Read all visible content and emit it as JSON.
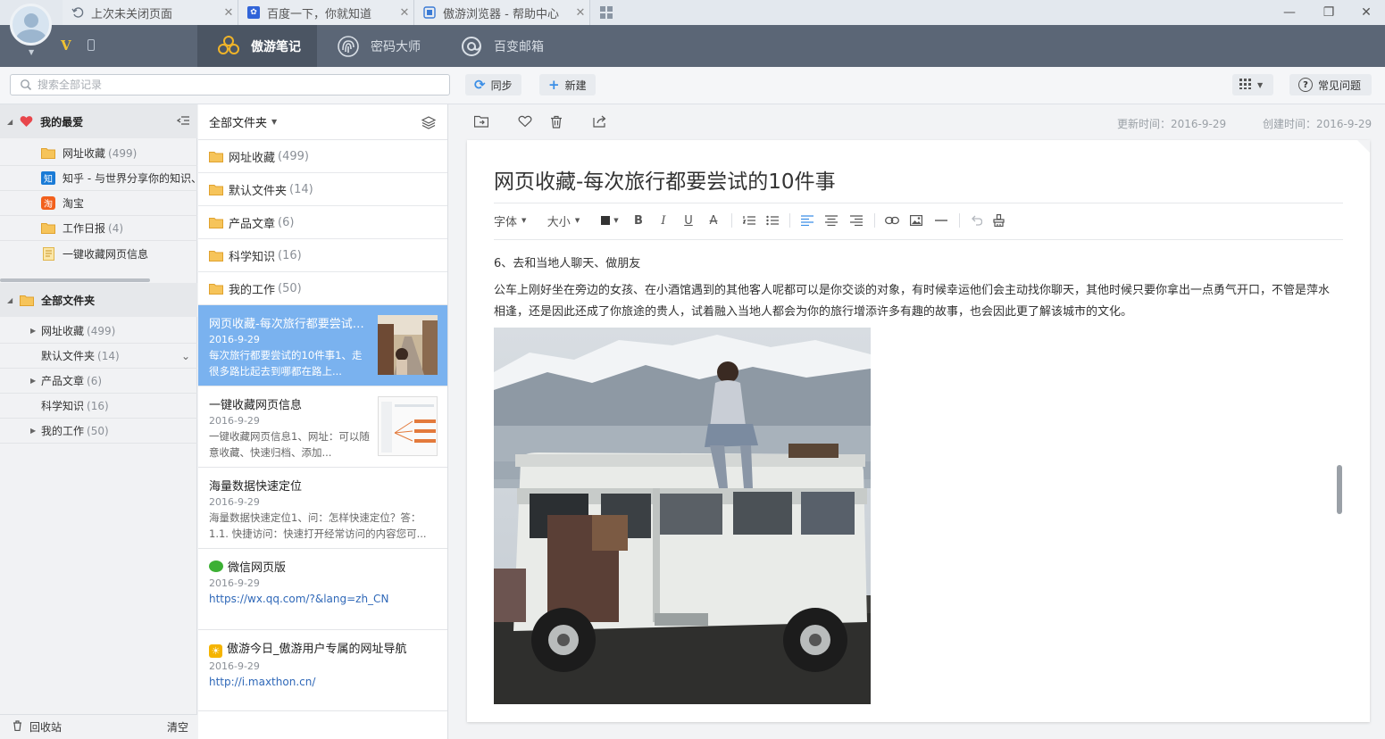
{
  "tabs": [
    {
      "label": "上次未关闭页面",
      "icon": "restore-icon"
    },
    {
      "label": "百度一下，你就知道",
      "icon": "baidu-icon"
    },
    {
      "label": "傲游浏览器 - 帮助中心",
      "icon": "maxthon-icon"
    }
  ],
  "header": {
    "badge": "V",
    "nav": [
      {
        "label": "傲游笔记",
        "icon": "note-flower-icon"
      },
      {
        "label": "密码大师",
        "icon": "fingerprint-icon"
      },
      {
        "label": "百变邮箱",
        "icon": "at-mail-icon"
      }
    ]
  },
  "toolbar": {
    "search_placeholder": "搜索全部记录",
    "sync_label": "同步",
    "new_label": "新建",
    "faq_label": "常见问题"
  },
  "sidebar": {
    "favorites_title": "我的最爱",
    "favorites": [
      {
        "label": "网址收藏",
        "count": "(499)",
        "icon": "folder-icon"
      },
      {
        "label": "知乎 - 与世界分享你的知识、",
        "count": "",
        "icon": "zhihu-icon"
      },
      {
        "label": "淘宝",
        "count": "",
        "icon": "taobao-icon"
      },
      {
        "label": "工作日报",
        "count": "(4)",
        "icon": "folder-icon"
      },
      {
        "label": "一键收藏网页信息",
        "count": "",
        "icon": "note-icon"
      }
    ],
    "folders_title": "全部文件夹",
    "folders": [
      {
        "label": "网址收藏",
        "count": "(499)"
      },
      {
        "label": "默认文件夹",
        "count": "(14)"
      },
      {
        "label": "产品文章",
        "count": "(6)"
      },
      {
        "label": "科学知识",
        "count": "(16)"
      },
      {
        "label": "我的工作",
        "count": "(50)"
      }
    ],
    "trash_label": "回收站",
    "clear_label": "清空"
  },
  "list": {
    "header": "全部文件夹",
    "folders": [
      {
        "label": "网址收藏",
        "count": "(499)"
      },
      {
        "label": "默认文件夹",
        "count": "(14)"
      },
      {
        "label": "产品文章",
        "count": "(6)"
      },
      {
        "label": "科学知识",
        "count": "(16)"
      },
      {
        "label": "我的工作",
        "count": "(50)"
      }
    ],
    "notes": [
      {
        "title": "网页收藏-每次旅行都要尝试的10件事",
        "date": "2016-9-29",
        "snippet": "每次旅行都要尝试的10件事1、走很多路比起去到哪都在路上..."
      },
      {
        "title": "一键收藏网页信息",
        "date": "2016-9-29",
        "snippet": "一键收藏网页信息1、网址：可以随意收藏、快速归档、添加..."
      },
      {
        "title": "海量数据快速定位",
        "date": "2016-9-29",
        "snippet": "海量数据快速定位1、问：怎样快速定位？答：1.1. 快捷访问：快速打开经常访问的内容您可..."
      },
      {
        "title": "微信网页版",
        "date": "2016-9-29",
        "link": "https://wx.qq.com/?&lang=zh_CN"
      },
      {
        "title": "傲游今日_傲游用户专属的网址导航",
        "date": "2016-9-29",
        "link": "http://i.maxthon.cn/"
      }
    ]
  },
  "editor": {
    "updated": "更新时间：2016-9-29",
    "created": "创建时间：2016-9-29",
    "title": "网页收藏-每次旅行都要尝试的10件事",
    "font_label": "字体",
    "size_label": "大小",
    "heading": "6、去和当地人聊天、做朋友",
    "paragraph": "公车上刚好坐在旁边的女孩、在小酒馆遇到的其他客人呢都可以是你交谈的对象，有时候幸运他们会主动找你聊天，其他时候只要你拿出一点勇气开口，不管是萍水相逢，还是因此还成了你旅途的贵人，试着融入当地人都会为你的旅行增添许多有趣的故事，也会因此更了解该城市的文化。"
  },
  "colors": {
    "header_bg": "#5b6676",
    "selected_note": "#7ab2ef",
    "accent": "#3a8ee6",
    "folder": "#f3b23a"
  }
}
